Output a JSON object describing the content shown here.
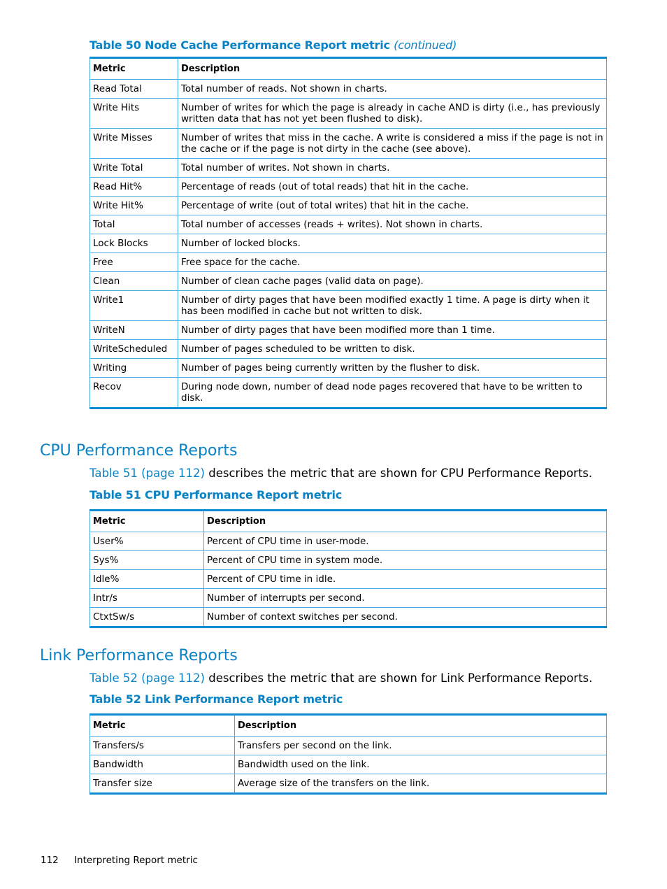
{
  "table50": {
    "caption": "Table 50 Node Cache Performance Report metric",
    "continued": "(continued)",
    "headers": [
      "Metric",
      "Description"
    ],
    "rows": [
      {
        "metric": "Read Total",
        "desc": "Total number of reads. Not shown in charts."
      },
      {
        "metric": "Write Hits",
        "desc": "Number of writes for which the page is already in cache AND is dirty (i.e., has previously written data that has not yet been flushed to disk)."
      },
      {
        "metric": "Write Misses",
        "desc": "Number of writes that miss in the cache. A write is considered a miss if the page is not in the cache or if the page is not dirty in the cache (see above)."
      },
      {
        "metric": "Write Total",
        "desc": "Total number of writes. Not shown in charts."
      },
      {
        "metric": "Read Hit%",
        "desc": "Percentage of reads (out of total reads) that hit in the cache."
      },
      {
        "metric": "Write Hit%",
        "desc": "Percentage of write (out of total writes) that hit in the cache."
      },
      {
        "metric": "Total",
        "desc": "Total number of accesses (reads + writes). Not shown in charts."
      },
      {
        "metric": "Lock Blocks",
        "desc": "Number of locked blocks."
      },
      {
        "metric": "Free",
        "desc": "Free space for the cache."
      },
      {
        "metric": "Clean",
        "desc": "Number of clean cache pages (valid data on page)."
      },
      {
        "metric": "Write1",
        "desc": "Number of dirty pages that have been modified exactly 1 time. A page is dirty when it has been modified in cache but not written to disk."
      },
      {
        "metric": "WriteN",
        "desc": "Number of dirty pages that have been modified more than 1 time."
      },
      {
        "metric": "WriteScheduled",
        "desc": "Number of pages scheduled to be written to disk."
      },
      {
        "metric": "Writing",
        "desc": "Number of pages being currently written by the flusher to disk."
      },
      {
        "metric": "Recov",
        "desc": "During node down, number of dead node pages recovered that have to be written to disk."
      }
    ]
  },
  "cpu_section": {
    "heading": "CPU Performance Reports",
    "intro_link": "Table 51 (page 112)",
    "intro_text": " describes the metric that are shown for CPU Performance Reports.",
    "caption": "Table 51 CPU Performance Report metric",
    "headers": [
      "Metric",
      "Description"
    ],
    "rows": [
      {
        "metric": "User%",
        "desc": "Percent of CPU time in user-mode."
      },
      {
        "metric": "Sys%",
        "desc": "Percent of CPU time in system mode."
      },
      {
        "metric": "Idle%",
        "desc": "Percent of CPU time in idle."
      },
      {
        "metric": "Intr/s",
        "desc": "Number of interrupts per second."
      },
      {
        "metric": "CtxtSw/s",
        "desc": "Number of context switches per second."
      }
    ]
  },
  "link_section": {
    "heading": "Link Performance Reports",
    "intro_link": "Table 52 (page 112)",
    "intro_text": " describes the metric that are shown for Link Performance Reports.",
    "caption": "Table 52 Link Performance Report metric",
    "headers": [
      "Metric",
      "Description"
    ],
    "rows": [
      {
        "metric": "Transfers/s",
        "desc": "Transfers per second on the link."
      },
      {
        "metric": "Bandwidth",
        "desc": "Bandwidth used on the link."
      },
      {
        "metric": "Transfer size",
        "desc": "Average size of the transfers on the link."
      }
    ]
  },
  "footer": {
    "page_number": "112",
    "section": "Interpreting Report metric"
  }
}
